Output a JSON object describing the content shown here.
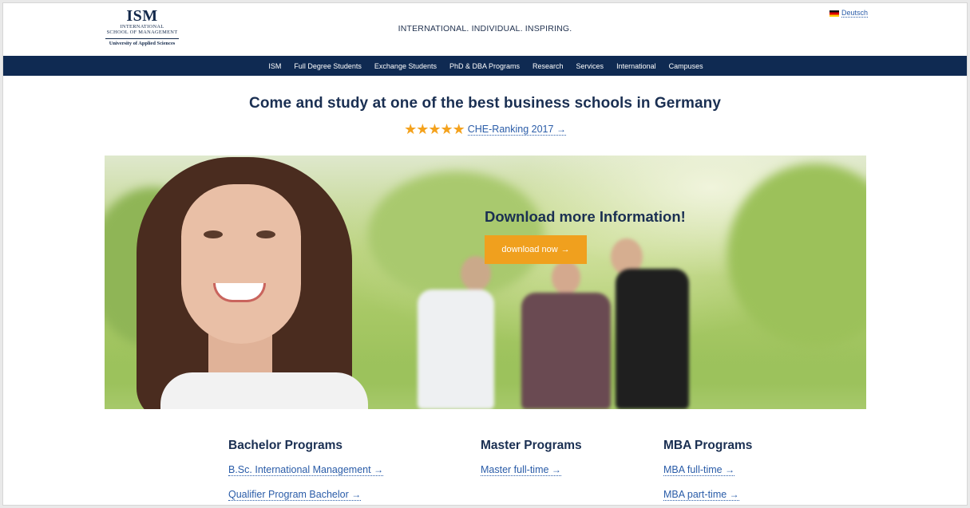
{
  "header": {
    "logo": {
      "main": "ISM",
      "line1": "INTERNATIONAL",
      "line2": "SCHOOL OF MANAGEMENT",
      "line3": "University of Applied Sciences"
    },
    "tagline": "INTERNATIONAL. INDIVIDUAL. INSPIRING.",
    "language": "Deutsch"
  },
  "nav": {
    "items": [
      "ISM",
      "Full Degree Students",
      "Exchange Students",
      "PhD & DBA Programs",
      "Research",
      "Services",
      "International",
      "Campuses"
    ]
  },
  "headline": "Come and study at one of the best business schools in Germany",
  "rating": {
    "stars": 5,
    "link": "CHE-Ranking 2017"
  },
  "hero": {
    "title": "Download more Information!",
    "button": "download now"
  },
  "programs": [
    {
      "title": "Bachelor Programs",
      "links": [
        "B.Sc. International Management",
        "Qualifier Program Bachelor"
      ]
    },
    {
      "title": "Master Programs",
      "links": [
        "Master full-time"
      ]
    },
    {
      "title": "MBA Programs",
      "links": [
        "MBA full-time",
        "MBA part-time"
      ]
    }
  ],
  "colors": {
    "navy": "#0f2a52",
    "accent_orange": "#f0a01e",
    "link_blue": "#2a5ca8"
  },
  "icons": {
    "arrow": "→",
    "star": "★",
    "flag": "german-flag-icon"
  }
}
